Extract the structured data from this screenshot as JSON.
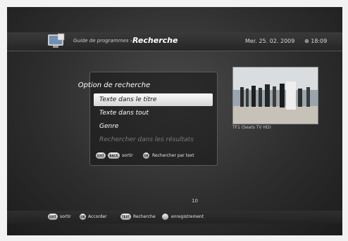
{
  "header": {
    "breadcrumb": "Guide de programmes ›",
    "title": "Recherche",
    "date": "Mer. 25. 02. 2009",
    "time": "⊕ 18:09"
  },
  "dialog": {
    "title": "Option de recherche",
    "items": [
      {
        "label": "Texte dans le titre",
        "state": "selected"
      },
      {
        "label": "Texte dans tout",
        "state": "normal"
      },
      {
        "label": "Genre",
        "state": "normal"
      },
      {
        "label": "Rechercher dans les résultats",
        "state": "disabled"
      }
    ],
    "hints": {
      "exit_key": "EXIT",
      "back_key": "BACK",
      "exit_label": "sortir",
      "ok_key": "OK",
      "ok_label": "Rechercher par text"
    }
  },
  "preview": {
    "caption": "TF1 (Seats TV HD)"
  },
  "page_number": "10",
  "footer": {
    "exit_key": "EXIT",
    "exit_label": "sortir",
    "ok_key": "OK",
    "ok_label": "Accorder",
    "text_key": "TEXT",
    "text_label": "Recherche",
    "rec_label": "enregistrement"
  },
  "colors": {
    "background": "#2e2e2e",
    "selected_item": "#e8e8e8",
    "disabled_item": "#7a7a7a"
  },
  "icons": [
    "tv-icon",
    "clock-icon",
    "record-icon"
  ]
}
